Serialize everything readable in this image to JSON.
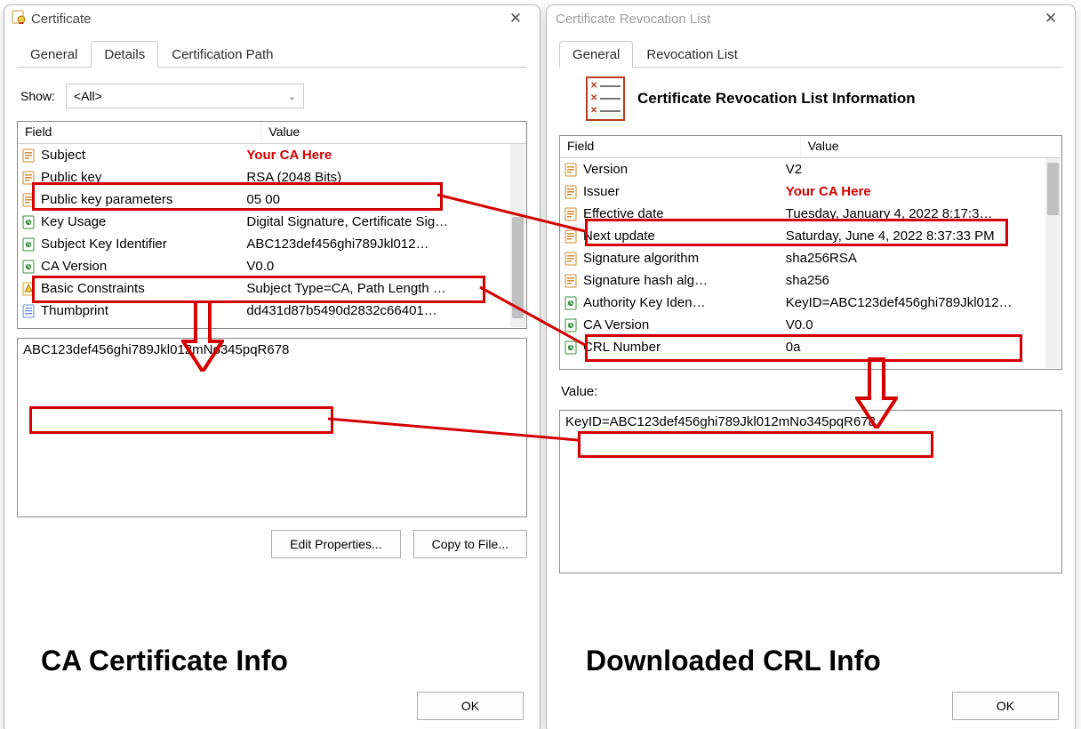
{
  "left": {
    "title": "Certificate",
    "tabs": [
      "General",
      "Details",
      "Certification Path"
    ],
    "active_tab": "Details",
    "show_label": "Show:",
    "show_value": "<All>",
    "col_field": "Field",
    "col_value": "Value",
    "rows": [
      {
        "icon": "doc",
        "field": "Subject",
        "value": "Your CA Here",
        "red": true
      },
      {
        "icon": "doc",
        "field": "Public key",
        "value": "RSA (2048 Bits)"
      },
      {
        "icon": "doc",
        "field": "Public key parameters",
        "value": "05 00"
      },
      {
        "icon": "ext",
        "field": "Key Usage",
        "value": "Digital Signature, Certificate Sig…"
      },
      {
        "icon": "ext",
        "field": "Subject Key Identifier",
        "value": "ABC123def456ghi789Jkl012…"
      },
      {
        "icon": "ext",
        "field": "CA Version",
        "value": "V0.0"
      },
      {
        "icon": "warn",
        "field": "Basic Constraints",
        "value": "Subject Type=CA, Path Length …"
      },
      {
        "icon": "thumb",
        "field": "Thumbprint",
        "value": "dd431d87b5490d2832c66401…"
      }
    ],
    "detail_value": "ABC123def456ghi789Jkl012mNo345pqR678",
    "btn_edit": "Edit Properties...",
    "btn_copy": "Copy to File...",
    "btn_ok": "OK",
    "caption": "CA Certificate Info"
  },
  "right": {
    "title": "Certificate Revocation List",
    "tabs": [
      "General",
      "Revocation List"
    ],
    "active_tab": "General",
    "heading": "Certificate Revocation List Information",
    "col_field": "Field",
    "col_value": "Value",
    "rows": [
      {
        "icon": "doc",
        "field": "Version",
        "value": "V2"
      },
      {
        "icon": "doc",
        "field": "Issuer",
        "value": "Your CA Here",
        "red": true
      },
      {
        "icon": "doc",
        "field": "Effective date",
        "value": "Tuesday, January 4, 2022 8:17:3…"
      },
      {
        "icon": "doc",
        "field": "Next update",
        "value": "Saturday, June 4, 2022 8:37:33 PM"
      },
      {
        "icon": "doc",
        "field": "Signature algorithm",
        "value": "sha256RSA"
      },
      {
        "icon": "doc",
        "field": "Signature hash alg…",
        "value": "sha256"
      },
      {
        "icon": "ext",
        "field": "Authority Key Iden…",
        "value": "KeyID=ABC123def456ghi789Jkl012…"
      },
      {
        "icon": "ext",
        "field": "CA Version",
        "value": "V0.0"
      },
      {
        "icon": "ext",
        "field": "CRL Number",
        "value": "0a"
      }
    ],
    "value_label": "Value:",
    "detail_value": "KeyID=ABC123def456ghi789Jkl012mNo345pqR678",
    "btn_ok": "OK",
    "caption": "Downloaded CRL Info"
  }
}
